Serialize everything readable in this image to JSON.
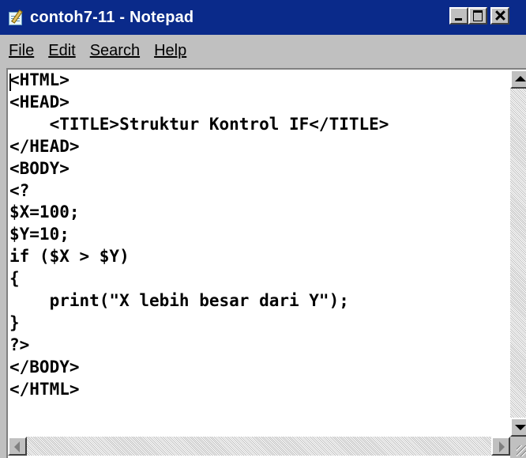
{
  "window": {
    "title": "contoh7-11 - Notepad",
    "icon": "notepad-icon",
    "controls": [
      "minimize-icon",
      "maximize-icon",
      "close-icon"
    ]
  },
  "menu": [
    {
      "label": "File"
    },
    {
      "label": "Edit"
    },
    {
      "label": "Search"
    },
    {
      "label": "Help"
    }
  ],
  "editor": {
    "lines": [
      "<HTML>",
      "<HEAD>",
      "    <TITLE>Struktur Kontrol IF</TITLE>",
      "</HEAD>",
      "<BODY>",
      "<?",
      "$X=100;",
      "$Y=10;",
      "if ($X > $Y)",
      "{",
      "    print(\"X lebih besar dari Y\");",
      "}",
      "?>",
      "</BODY>",
      "</HTML>"
    ]
  },
  "colors": {
    "titlebar": "#0a2a8a",
    "chrome": "#c0c0c0",
    "text_area": "#ffffff"
  }
}
